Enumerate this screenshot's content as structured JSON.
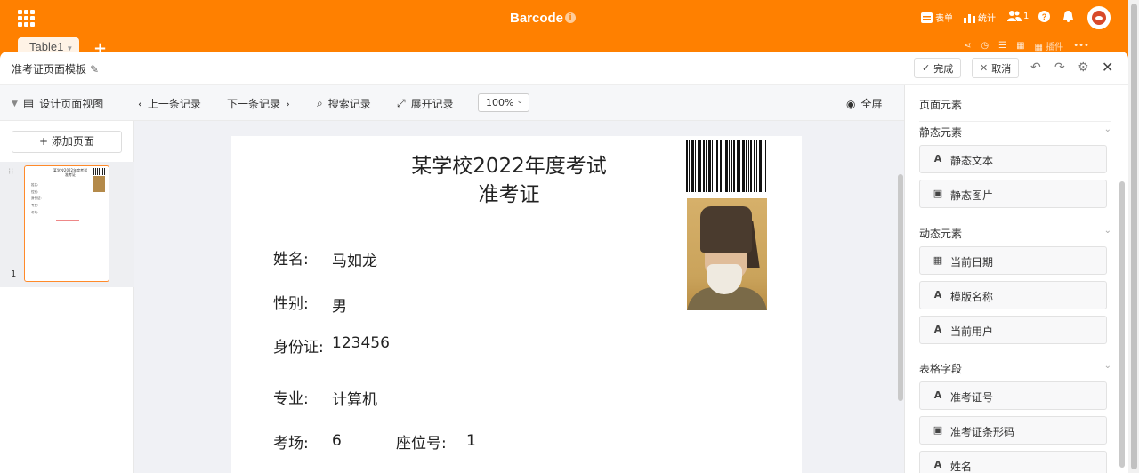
{
  "app": {
    "title": "Barcode",
    "info_icon": "info-icon",
    "form_label": "表单",
    "stats_label": "统计",
    "members_count": "1",
    "tab_label": "Table1",
    "plugin_label": "插件",
    "accent_color": "#ff8000"
  },
  "editor": {
    "title": "准考证页面模板",
    "done_label": "完成",
    "cancel_label": "取消"
  },
  "toolbar": {
    "design_view": "设计页面视图",
    "prev_record": "上一条记录",
    "next_record": "下一条记录",
    "search_record": "搜索记录",
    "expand_record": "展开记录",
    "zoom": "100%",
    "fullscreen": "全屏"
  },
  "pages": {
    "add_page": "添加页面",
    "thumb_number": "1",
    "thumb_title": "某学校2022年度考试 准考证"
  },
  "document": {
    "title_line1": "某学校2022年度考试",
    "title_line2": "准考证",
    "name_label": "姓名:",
    "name_value": "马如龙",
    "gender_label": "性别:",
    "gender_value": "男",
    "id_label": "身份证:",
    "id_value": "123456",
    "major_label": "专业:",
    "major_value": "计算机",
    "room_label": "考场:",
    "room_value": "6",
    "seat_label": "座位号:",
    "seat_value": "1"
  },
  "right_panel": {
    "title": "页面元素",
    "static_section": "静态元素",
    "static_text": "静态文本",
    "static_image": "静态图片",
    "dynamic_section": "动态元素",
    "current_date": "当前日期",
    "template_name": "模版名称",
    "current_user": "当前用户",
    "table_section": "表格字段",
    "ticket_number": "准考证号",
    "ticket_barcode": "准考证条形码",
    "name_field": "姓名"
  }
}
